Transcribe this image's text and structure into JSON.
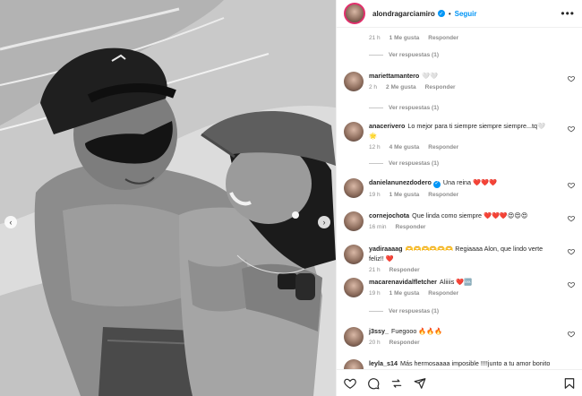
{
  "header": {
    "username": "alondragarciamiro",
    "follow": "Seguir",
    "more": "•••",
    "separator": "•"
  },
  "top_meta": {
    "time": "21 h",
    "likes": "1 Me gusta",
    "reply": "Responder"
  },
  "top_ver_respuestas": "Ver respuestas (1)",
  "comments": [
    {
      "user": "mariettamantero",
      "text": "🤍🤍",
      "time": "2 h",
      "likes": "2 Me gusta",
      "reply": "Responder",
      "replies": "Ver respuestas (1)"
    },
    {
      "user": "anacerivero",
      "text": "Lo mejor para ti siempre siempre siempre...tq🤍 🌟",
      "time": "12 h",
      "likes": "4 Me gusta",
      "reply": "Responder",
      "replies": "Ver respuestas (1)"
    },
    {
      "user": "danielanunezdodero",
      "verified": true,
      "text": "Una reina ❤️❤️❤️",
      "time": "19 h",
      "likes": "1 Me gusta",
      "reply": "Responder",
      "replies": ""
    },
    {
      "user": "cornejochota",
      "text": "Que linda como siempre ❤️❤️❤️😍😍😍",
      "time": "16 min",
      "likes": "",
      "reply": "Responder",
      "replies": ""
    },
    {
      "user": "yadiraaaag",
      "text": "🫶🫶🫶🫶🫶🫶 Regiaaaa Alon, que lindo verte feliz!! ❤️",
      "time": "21 h",
      "likes": "",
      "reply": "Responder",
      "replies": ""
    },
    {
      "user": "macarenavidalfletcher",
      "text": "Aliiiis ❤️🆒",
      "time": "19 h",
      "likes": "1 Me gusta",
      "reply": "Responder",
      "replies": "Ver respuestas (1)"
    },
    {
      "user": "j3ssy_",
      "text": "Fuegooo 🔥🔥🔥",
      "time": "20 h",
      "likes": "",
      "reply": "Responder",
      "replies": ""
    },
    {
      "user": "leyla_s14",
      "text": "Más hermosaaaa imposible !!!!junto a tu amor bonito",
      "time": "",
      "likes": "",
      "reply": "",
      "replies": ""
    }
  ],
  "icons": {
    "like": "heart-icon",
    "comment": "comment-icon",
    "share": "share-icon",
    "send": "send-icon",
    "save": "bookmark-icon"
  },
  "colors": {
    "accent": "#0095f6",
    "muted": "#8e8e8e",
    "text": "#262626",
    "story_ring": "#e1306c"
  }
}
